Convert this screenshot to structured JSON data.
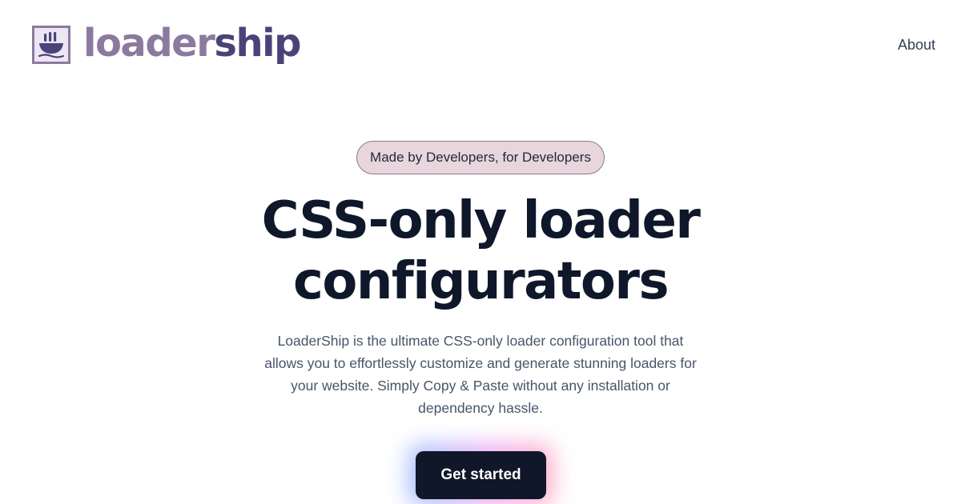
{
  "header": {
    "logo": {
      "icon": "loadership-logo-icon",
      "text_part1": "loader",
      "text_part2": "ship",
      "colors": {
        "frame": "#8b7a9e",
        "part1": "#8b7a9e",
        "part2": "#4a437a"
      }
    },
    "nav": {
      "about_label": "About"
    }
  },
  "hero": {
    "badge": "Made by Developers, for Developers",
    "title_line1": "CSS-only loader",
    "title_line2": "configurators",
    "description": "LoaderShip is the ultimate CSS-only loader configuration tool that allows you to effortlessly customize and generate stunning loaders for your website. Simply Copy & Paste without any installation or dependency hassle.",
    "cta_label": "Get started"
  },
  "colors": {
    "badge_background": "#e9d5dc",
    "cta_background": "#0f1729",
    "heading": "#0f172a"
  }
}
